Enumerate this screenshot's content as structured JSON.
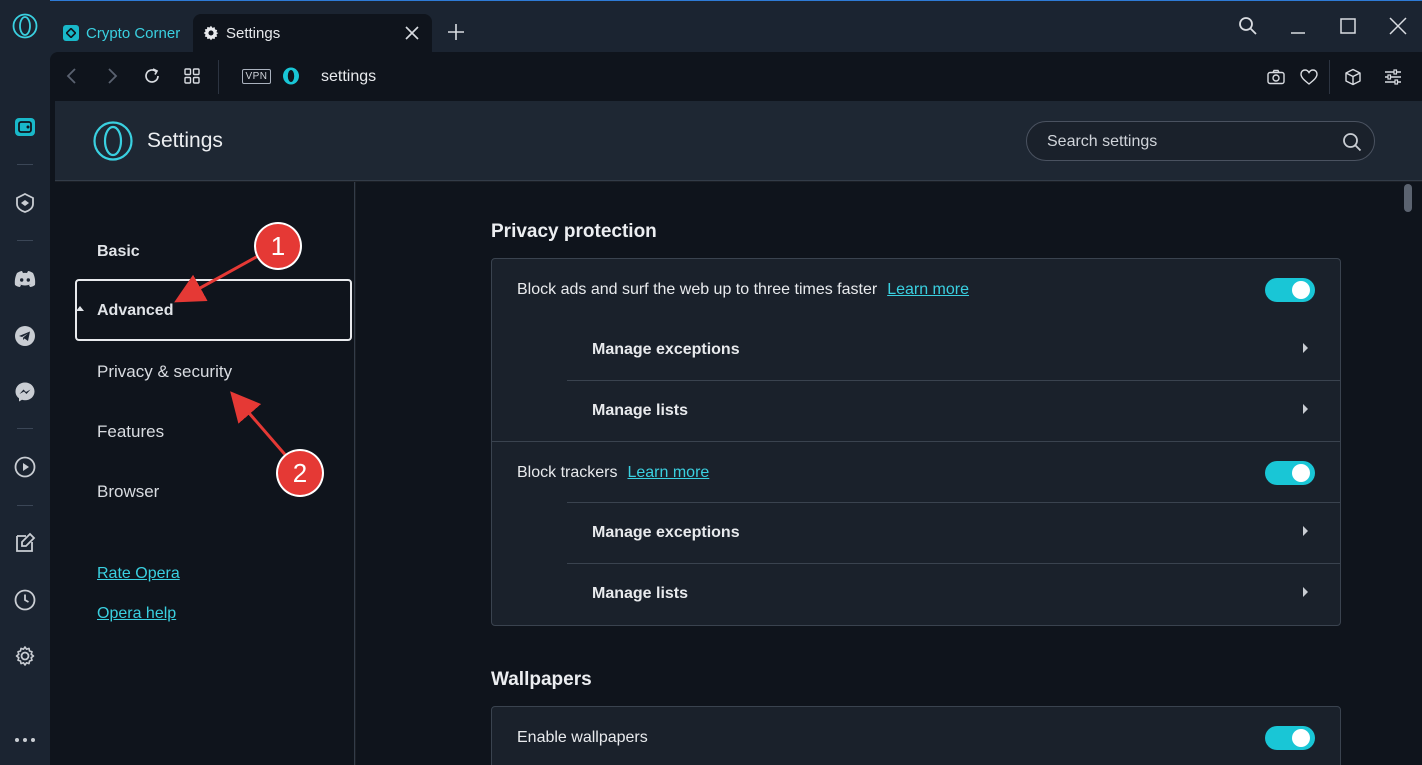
{
  "tabs": [
    {
      "label": "Crypto Corner",
      "active": false
    },
    {
      "label": "Settings",
      "active": true
    }
  ],
  "address_bar": {
    "vpn_label": "VPN",
    "url": "settings"
  },
  "header": {
    "title": "Settings",
    "search_placeholder": "Search settings"
  },
  "nav": {
    "basic": "Basic",
    "advanced": "Advanced",
    "privacy": "Privacy & security",
    "features": "Features",
    "browser": "Browser",
    "rate": "Rate Opera",
    "help": "Opera help"
  },
  "privacy_section": {
    "title": "Privacy protection",
    "block_ads": "Block ads and surf the web up to three times faster",
    "block_trackers": "Block trackers",
    "learn_more": "Learn more",
    "manage_exceptions": "Manage exceptions",
    "manage_lists": "Manage lists",
    "block_ads_enabled": true,
    "block_trackers_enabled": true
  },
  "wallpapers_section": {
    "title": "Wallpapers",
    "enable": "Enable wallpapers",
    "enabled": true
  },
  "annotations": [
    "1",
    "2"
  ],
  "colors": {
    "accent": "#19c6d6",
    "annotation": "#e53935"
  }
}
